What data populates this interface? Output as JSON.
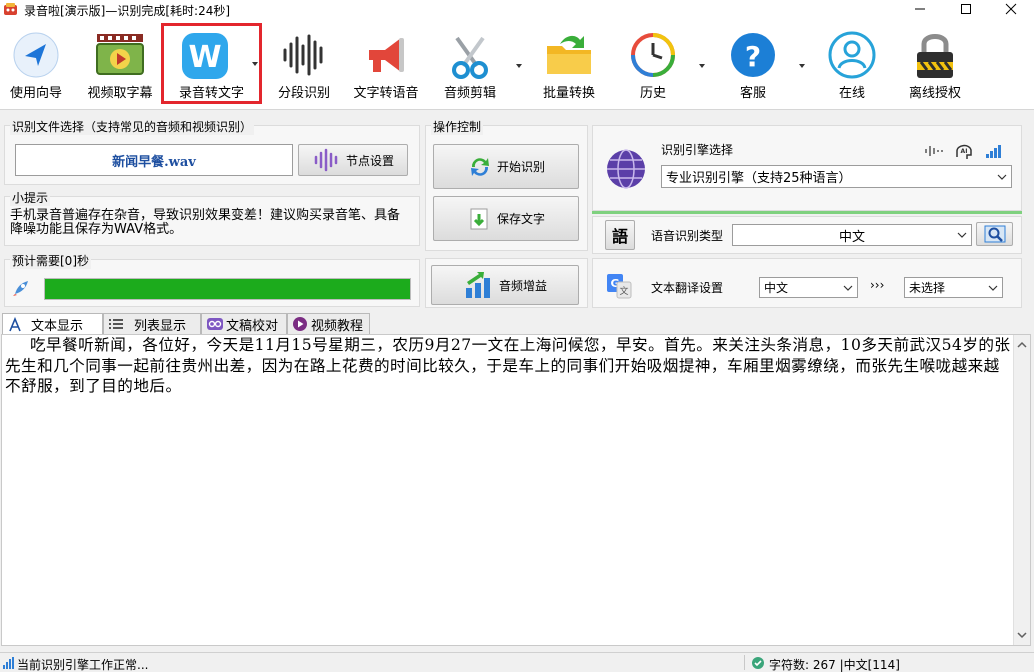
{
  "window": {
    "title": "录音啦[演示版]—识别完成[耗时:24秒]"
  },
  "toolbar": {
    "items": [
      {
        "label": "使用向导",
        "icon": "navigation-arrow-icon"
      },
      {
        "label": "视频取字幕",
        "icon": "video-film-icon"
      },
      {
        "label": "录音转文字",
        "icon": "w-badge-icon",
        "selected": true
      },
      {
        "label": "分段识别",
        "icon": "waveform-icon"
      },
      {
        "label": "文字转语音",
        "icon": "megaphone-icon"
      },
      {
        "label": "音频剪辑",
        "icon": "scissors-icon"
      },
      {
        "label": "批量转换",
        "icon": "folder-arrow-icon"
      },
      {
        "label": "历史",
        "icon": "history-clock-icon"
      },
      {
        "label": "客服",
        "icon": "question-icon"
      },
      {
        "label": "在线",
        "icon": "user-online-icon"
      },
      {
        "label": "离线授权",
        "icon": "padlock-icon"
      }
    ]
  },
  "file_group": {
    "title": "识别文件选择（支持常见的音频和视频识别）",
    "file_name": "新闻早餐.wav",
    "node_button": "节点设置"
  },
  "tips": {
    "title": "小提示",
    "text": "手机录音普遍存在杂音，导致识别效果变差！建议购买录音笔、具备降噪功能且保存为WAV格式。"
  },
  "estimate": {
    "title": "预计需要[0]秒",
    "progress": 1.0
  },
  "operation": {
    "title": "操作控制",
    "start_button": "开始识别",
    "save_button": "保存文字",
    "boost_button": "音频增益"
  },
  "engine": {
    "title": "识别引擎选择",
    "selected": "专业识别引擎（支持25种语言）"
  },
  "recog_type": {
    "badge": "語",
    "label": "语音识别类型",
    "selected": "中文"
  },
  "translate": {
    "label": "文本翻译设置",
    "from": "中文",
    "arrows": "›››",
    "to": "未选择"
  },
  "tabs": [
    {
      "label": "文本显示",
      "icon": "text-a-icon",
      "active": true
    },
    {
      "label": "列表显示",
      "icon": "list-icon"
    },
    {
      "label": "文稿校对",
      "icon": "compare-icon"
    },
    {
      "label": "视频教程",
      "icon": "play-icon"
    }
  ],
  "transcript": "吃早餐听新闻，各位好，今天是11月15号星期三，农历9月27一文在上海问候您，早安。首先。来关注头条消息，10多天前武汉54岁的张先生和几个同事一起前往贵州出差，因为在路上花费的时间比较久，于是车上的同事们开始吸烟提神，车厢里烟雾缭绕，而张先生喉咙越来越不舒服，到了目的地后。",
  "status": {
    "left": "当前识别引擎工作正常...",
    "right": "字符数: 267 |中文[114]"
  },
  "colors": {
    "accent_red": "#e3262d",
    "progress_green": "#1cab1c",
    "link_blue": "#1e4fa0"
  }
}
